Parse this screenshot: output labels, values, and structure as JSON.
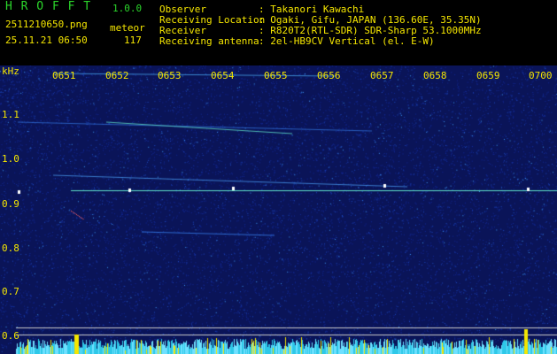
{
  "app": {
    "name_letters": "H R O F F T",
    "version": "1.0.0",
    "filename": "2511210650.png",
    "datetime": "25.11.21 06:50",
    "meteor_label": "meteor",
    "meteor_count": "117"
  },
  "info": {
    "rows": [
      {
        "label": "Observer",
        "value": ": Takanori Kawachi"
      },
      {
        "label": "Receiving Location",
        "value": ": Ogaki, Gifu, JAPAN (136.60E, 35.35N)"
      },
      {
        "label": "Receiver",
        "value": ": R820T2(RTL-SDR) SDR-Sharp 53.1000MHz"
      },
      {
        "label": "Receiving antenna",
        "value": ": 2el-HB9CV Vertical (el. E-W)"
      }
    ]
  },
  "axis": {
    "unit": "kHz",
    "y_ticks": [
      "1.1",
      "1.0",
      "0.9",
      "0.8",
      "0.7",
      "0.6"
    ],
    "x_ticks": [
      "0651",
      "0652",
      "0653",
      "0654",
      "0655",
      "0656",
      "0657",
      "0658",
      "0659",
      "0700"
    ]
  },
  "colors": {
    "background": "#000000",
    "spectrogram_bg": "#0a1458",
    "signal_line": "#5fe0c8",
    "label_yellow": "#f5e600",
    "label_green": "#2bd62b",
    "meteor_bar": "#f5e600"
  }
}
